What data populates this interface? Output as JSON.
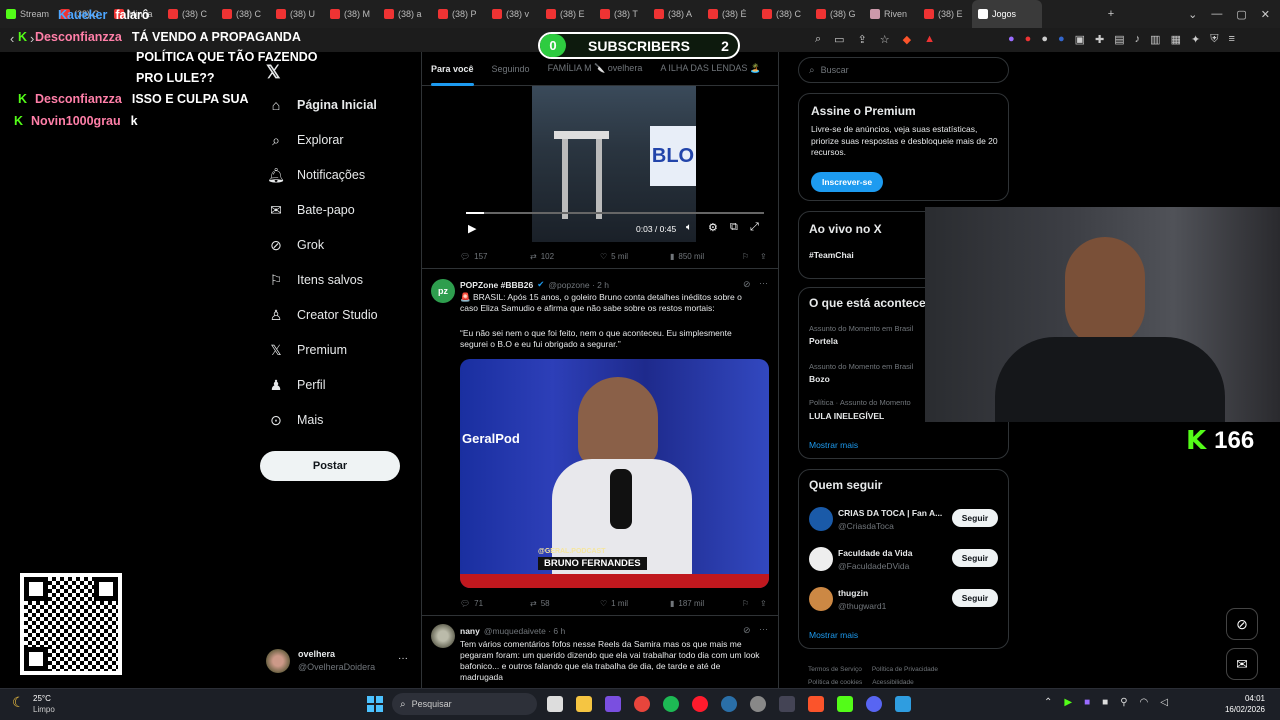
{
  "browser": {
    "tabs": [
      "Stream",
      "(38) C",
      "Minha",
      "(38) C",
      "(38) C",
      "(38) U",
      "(38) M",
      "(38) a",
      "(38) P",
      "(38) v",
      "(38) E",
      "(38) T",
      "(38) A",
      "(38) É",
      "(38) C",
      "(38) G",
      "Riven",
      "(38) E",
      "Jogos"
    ],
    "active_tab": "Jogos",
    "new_tab": "+"
  },
  "overlay": {
    "chat": [
      {
        "user": "Kaueker",
        "text": "falarô"
      },
      {
        "user": "Desconfianzza",
        "text": "TÁ VENDO A PROPAGANDA"
      },
      {
        "user": "",
        "text": "POLÍTICA QUE TÃO FAZENDO"
      },
      {
        "user": "",
        "text": "PRO LULE??"
      },
      {
        "user": "Desconfianzza",
        "text": "ISSO E CULPA SUA"
      },
      {
        "user": "Novin1000grau",
        "text": "k"
      }
    ],
    "subscribers": {
      "left": "0",
      "label": "SUBSCRIBERS",
      "right": "2"
    },
    "viewer_count": "166"
  },
  "nav": {
    "items": [
      "Página Inicial",
      "Explorar",
      "Notificações",
      "Bate-papo",
      "Grok",
      "Itens salvos",
      "Creator Studio",
      "Premium",
      "Perfil",
      "Mais"
    ],
    "post": "Postar",
    "account": {
      "name": "ovelhera",
      "handle": "@OvelheraDoidera",
      "more": "···"
    }
  },
  "feed": {
    "tabs": [
      "Para você",
      "Seguindo",
      "FAMÍLIA M 🔪 ovelhera",
      "A ILHA DAS LENDAS 🏝️"
    ],
    "video1": {
      "time": "0:03 / 0:45",
      "stats": [
        "157",
        "102",
        "5 mil",
        "850 mil"
      ]
    },
    "tweet2": {
      "name": "POPZone #BBB26",
      "handle": "@popzone · 2 h",
      "avatar": "pz",
      "text": "🚨 BRASIL: Após 15 anos, o goleiro Bruno conta detalhes inéditos sobre o caso Eliza Samudio e afirma que não sabe sobre os restos mortais:",
      "quote": "“Eu não sei nem o que foi feito, nem o que aconteceu. Eu simplesmente segurei o B.O e eu fui obrigado a segurar.”",
      "image_caption": "BRUNO FERNANDES",
      "image_sub": "@GERAL.PODCAST",
      "stats": [
        "71",
        "58",
        "1 mil",
        "187 mil"
      ]
    },
    "tweet3": {
      "name": "nany",
      "handle": "@muquedaivete · 6 h",
      "text": "Tem vários comentários fofos nesse Reels da Samira mas os que mais me pegaram foram: um querido dizendo que ela vai trabalhar todo dia com um look bafonico... e outros falando que ela trabalha de dia, de tarde e até de madrugada"
    }
  },
  "sidebar": {
    "search_placeholder": "Buscar",
    "premium": {
      "title": "Assine o Premium",
      "text": "Livre-se de anúncios, veja suas estatísticas, priorize suas respostas e desbloqueie mais de 20 recursos.",
      "button": "Inscrever-se"
    },
    "live": {
      "title": "Ao vivo no X",
      "tag": "#TeamChai"
    },
    "trends": {
      "title": "O que está acontecendo",
      "items": [
        {
          "meta": "Assunto do Momento em Brasil",
          "name": "Portela"
        },
        {
          "meta": "Assunto do Momento em Brasil",
          "name": "Bozo"
        },
        {
          "meta": "Política · Assunto do Momento",
          "name": "LULA INELEGÍVEL"
        }
      ],
      "more": "Mostrar mais"
    },
    "follow": {
      "title": "Quem seguir",
      "items": [
        {
          "name": "CRIAS DA TOCA | Fan A...",
          "handle": "@CriasdaToca",
          "button": "Seguir"
        },
        {
          "name": "Faculdade da Vida",
          "handle": "@FaculdadeDVida",
          "button": "Seguir"
        },
        {
          "name": "thugzin",
          "handle": "@thugward1",
          "button": "Seguir"
        }
      ],
      "more": "Mostrar mais"
    },
    "footer": [
      "Termos de Serviço",
      "Política de Privacidade",
      "Política de cookies",
      "Acessibilidade"
    ]
  },
  "taskbar": {
    "weather": {
      "temp": "25°C",
      "cond": "Limpo"
    },
    "search": "Pesquisar",
    "time": "04:01",
    "date": "16/02/2026"
  },
  "colors": {
    "accent": "#1d9bf0",
    "kick": "#53fc18",
    "chat_user": "#ff7fa8"
  }
}
